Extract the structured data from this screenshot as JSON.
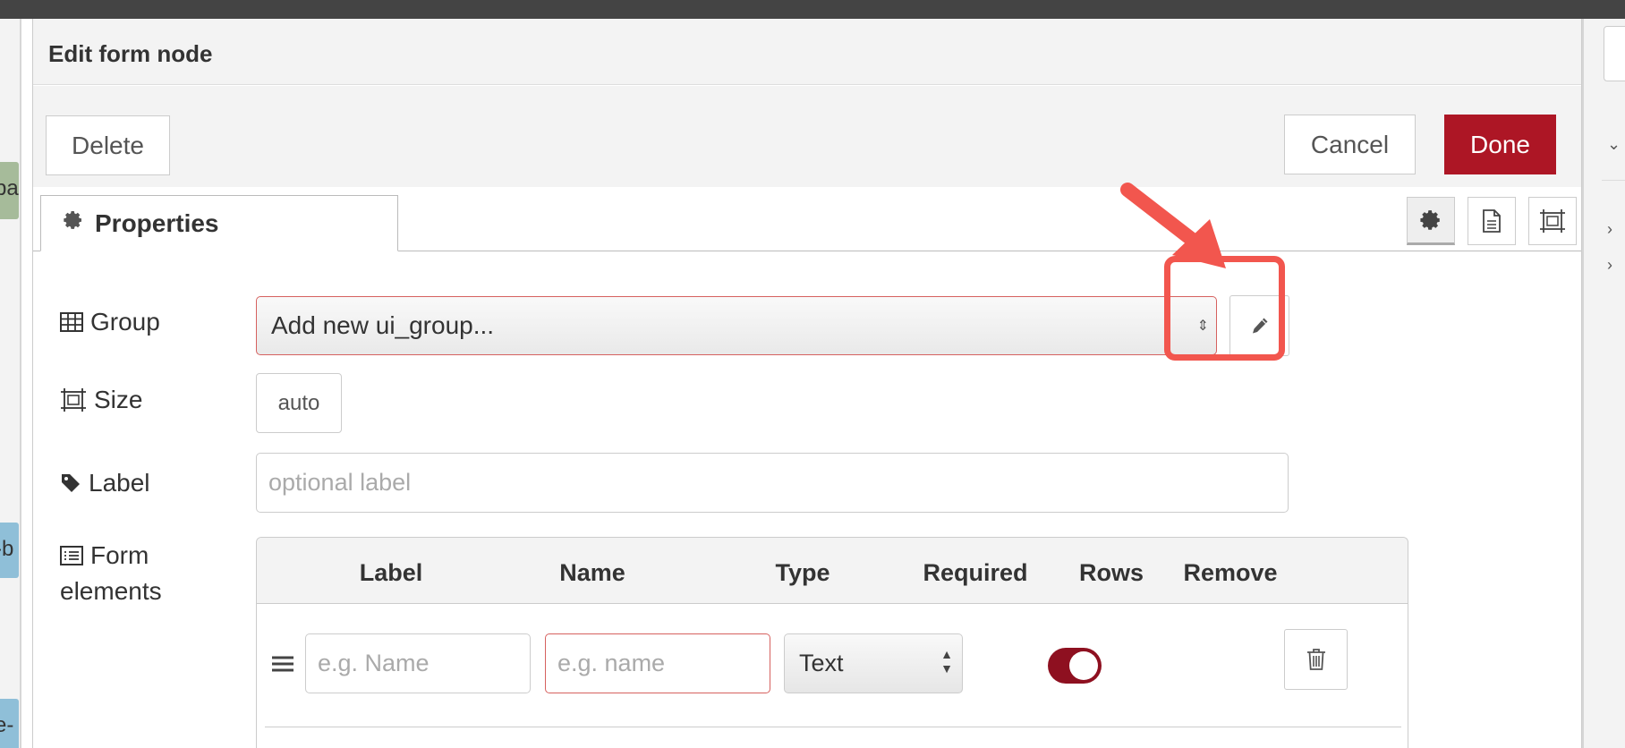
{
  "dialog": {
    "title": "Edit form node",
    "delete_label": "Delete",
    "cancel_label": "Cancel",
    "done_label": "Done",
    "tab_properties": "Properties"
  },
  "background": {
    "left_node_1": "pa",
    "left_node_2": "-b",
    "left_node_3": "e-"
  },
  "fields": {
    "group": {
      "label": "Group",
      "value": "Add new ui_group..."
    },
    "size": {
      "label": "Size",
      "value": "auto"
    },
    "label": {
      "label": "Label",
      "placeholder": "optional label"
    },
    "form_elements": {
      "label_line1": "Form",
      "label_line2": "elements"
    }
  },
  "form_table": {
    "columns": [
      "Label",
      "Name",
      "Type",
      "Required",
      "Rows",
      "Remove"
    ],
    "row": {
      "label_placeholder": "e.g. Name",
      "name_placeholder": "e.g. name",
      "type_value": "Text",
      "required": true
    }
  },
  "colors": {
    "done_button": "#ad1625",
    "toggle_on": "#8e1020",
    "highlight": "#f2564e",
    "invalid_border": "#d6615f"
  },
  "icons": {
    "tab": "gear-icon",
    "group": "table-icon",
    "size": "resize-icon",
    "label": "tag-icon",
    "form_elements": "list-icon",
    "edit": "pencil-icon",
    "remove": "trash-icon",
    "drag": "drag-handle-icon"
  }
}
